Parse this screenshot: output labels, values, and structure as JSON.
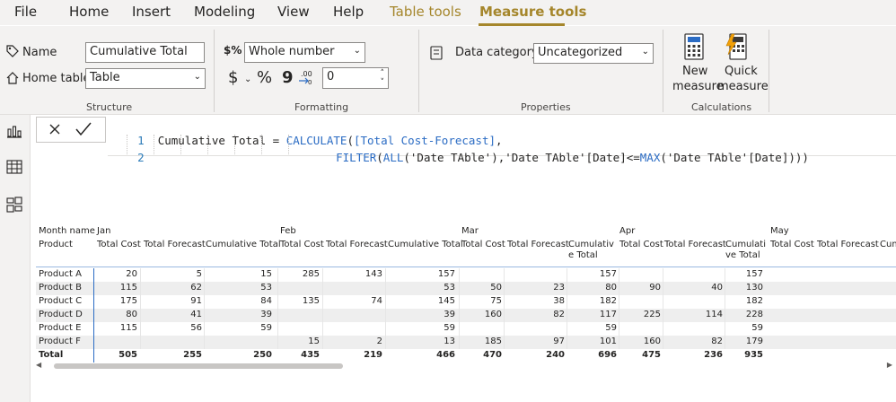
{
  "menu": {
    "items": [
      "File",
      "Home",
      "Insert",
      "Modeling",
      "View",
      "Help"
    ],
    "context_tab": "Table tools",
    "active_tab": "Measure tools",
    "accent_color": "#a5862b"
  },
  "structure": {
    "name_label": "Name",
    "name_value": "Cumulative Total",
    "home_table_label": "Home table",
    "home_table_value": "Table",
    "group_label": "Structure"
  },
  "formatting": {
    "format_value": "Whole number",
    "currency_symbol": "$",
    "percent_symbol": "%",
    "comma_symbol": "9",
    "decimals_value": "0",
    "group_label": "Formatting"
  },
  "properties": {
    "data_category_label": "Data category",
    "data_category_value": "Uncategorized",
    "group_label": "Properties"
  },
  "calculations": {
    "new_measure_line1": "New",
    "new_measure_line2": "measure",
    "quick_measure_line1": "Quick",
    "quick_measure_line2": "measure",
    "group_label": "Calculations"
  },
  "formula": {
    "line1_num": "1",
    "line2_num": "2",
    "line1_prefix": "Cumulative Total = ",
    "line1_fn": "CALCULATE",
    "line1_paren": "(",
    "line1_measure": "[Total Cost-Forecast]",
    "line1_suffix": ",",
    "line2_fn1": "FILTER",
    "line2_p1": "(",
    "line2_fn2": "ALL",
    "line2_mid": "('Date TAble'),'Date TAble'[Date]<=",
    "line2_fn3": "MAX",
    "line2_end": "('Date TAble'[Date])))"
  },
  "matrix": {
    "header_month": "Month name",
    "header_product": "Product",
    "months": [
      "Jan",
      "Feb",
      "Mar",
      "Apr",
      "May"
    ],
    "col_labels": [
      "Total Cost",
      "Total Forecast",
      "Cumulative Total"
    ],
    "wrapped_cumulative_a": "Cumulativ",
    "wrapped_cumulative_b": "e Total",
    "wrapped_cumulative_c": "Cumulati",
    "wrapped_cumulative_d": "ve Total",
    "trailing_label": "Cum",
    "rows": [
      {
        "product": "Product A",
        "vals": [
          "20",
          "5",
          "15",
          "285",
          "143",
          "157",
          "",
          "",
          "157",
          "",
          "",
          "157"
        ]
      },
      {
        "product": "Product B",
        "vals": [
          "115",
          "62",
          "53",
          "",
          "",
          "53",
          "50",
          "23",
          "80",
          "90",
          "40",
          "130"
        ]
      },
      {
        "product": "Product C",
        "vals": [
          "175",
          "91",
          "84",
          "135",
          "74",
          "145",
          "75",
          "38",
          "182",
          "",
          "",
          "182"
        ]
      },
      {
        "product": "Product D",
        "vals": [
          "80",
          "41",
          "39",
          "",
          "",
          "39",
          "160",
          "82",
          "117",
          "225",
          "114",
          "228"
        ]
      },
      {
        "product": "Product E",
        "vals": [
          "115",
          "56",
          "59",
          "",
          "",
          "59",
          "",
          "",
          "59",
          "",
          "",
          "59"
        ]
      },
      {
        "product": "Product F",
        "vals": [
          "",
          "",
          "",
          "15",
          "2",
          "13",
          "185",
          "97",
          "101",
          "160",
          "82",
          "179"
        ]
      }
    ],
    "total": {
      "product": "Total",
      "vals": [
        "505",
        "255",
        "250",
        "435",
        "219",
        "466",
        "470",
        "240",
        "696",
        "475",
        "236",
        "935"
      ]
    }
  }
}
